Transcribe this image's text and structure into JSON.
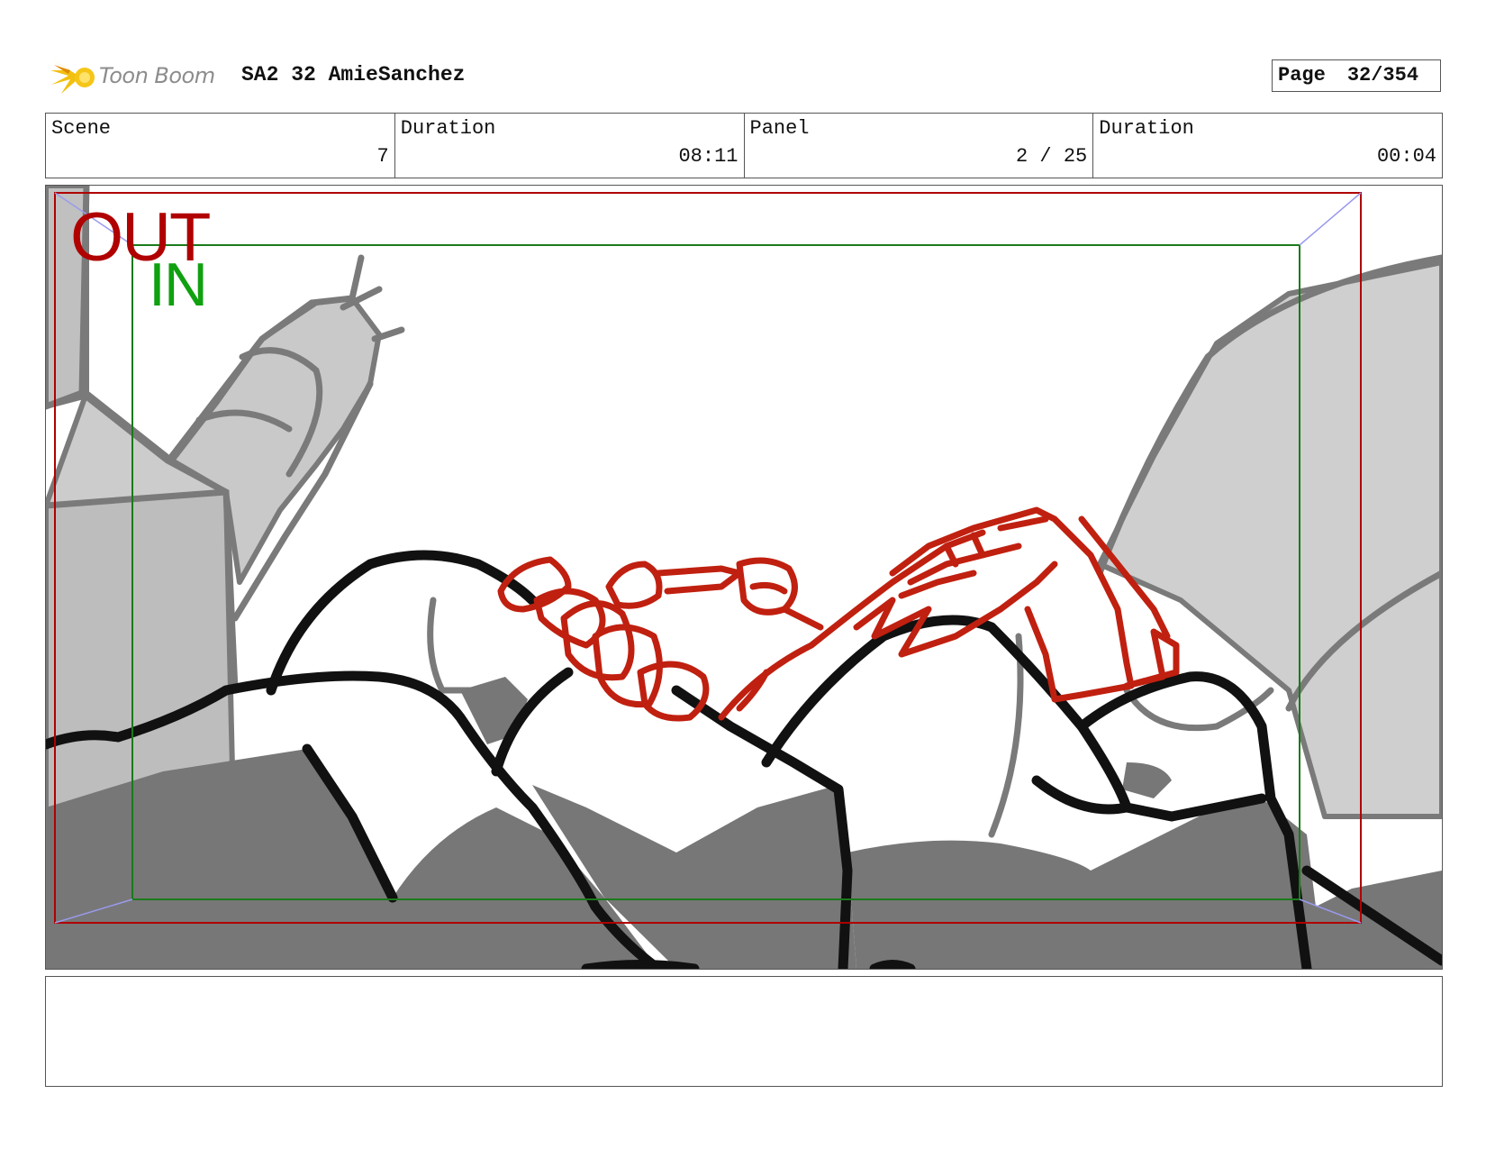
{
  "header": {
    "logo_text": "Toon Boom",
    "title": "SA2 32 AmieSanchez",
    "page_label": "Page",
    "page_number": "32/354"
  },
  "info": {
    "scene_label": "Scene",
    "scene_value": "7",
    "scene_duration_label": "Duration",
    "scene_duration_value": "08:11",
    "panel_label": "Panel",
    "panel_value": "2 / 25",
    "panel_duration_label": "Duration",
    "panel_duration_value": "00:04"
  },
  "frame": {
    "out_label": "OUT",
    "in_label": "IN"
  },
  "notes": {
    "text": ""
  },
  "colors": {
    "out_frame": "#b00000",
    "in_frame": "#1a7a1a",
    "sketch_red": "#c02010",
    "sketch_black": "#111111",
    "shade_gray": "#7a7a7a",
    "light_gray": "#c8c8c8"
  },
  "icons": {
    "logo": "toon-boom-star-icon"
  }
}
